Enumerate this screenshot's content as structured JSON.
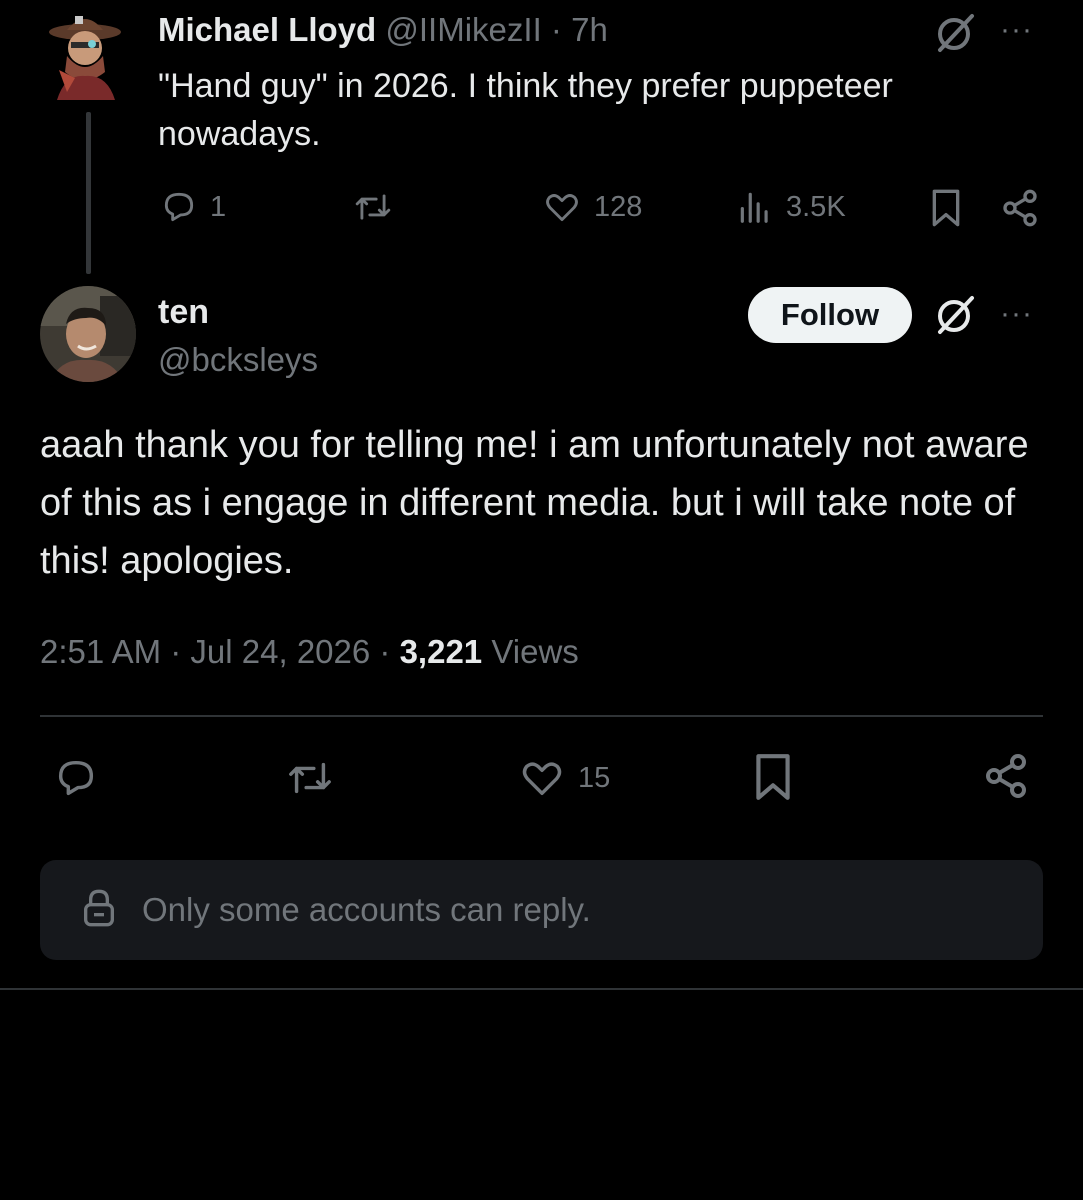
{
  "parent_tweet": {
    "name": "Michael Lloyd",
    "handle": "@IIMikezII",
    "separator": "·",
    "time": "7h",
    "text": "\"Hand guy\" in 2026. I think they prefer puppeteer nowadays.",
    "more": "···",
    "replies": "1",
    "retweets": "",
    "likes": "128",
    "views": "3.5K"
  },
  "reply_tweet": {
    "name": "ten",
    "handle": "@bcksleys",
    "follow_label": "Follow",
    "more": "···",
    "text": "aaah thank you for telling me! i am unfortunately  not aware of this as i engage in different media. but i will take note of this! apologies.",
    "time": "2:51 AM",
    "dot": "·",
    "date": "Jul 24, 2026",
    "views_count": "3,221",
    "views_label": "Views",
    "likes": "15"
  },
  "reply_restriction": {
    "text": "Only some accounts can reply."
  },
  "colors": {
    "background": "#000000",
    "text": "#e7e9ea",
    "muted": "#71767b",
    "divider": "#2f3336",
    "follow_bg": "#eff3f4"
  },
  "icons": [
    "reply-icon",
    "retweet-icon",
    "like-icon",
    "views-icon",
    "bookmark-icon",
    "share-icon",
    "grok-icon",
    "more-icon",
    "lock-icon"
  ]
}
